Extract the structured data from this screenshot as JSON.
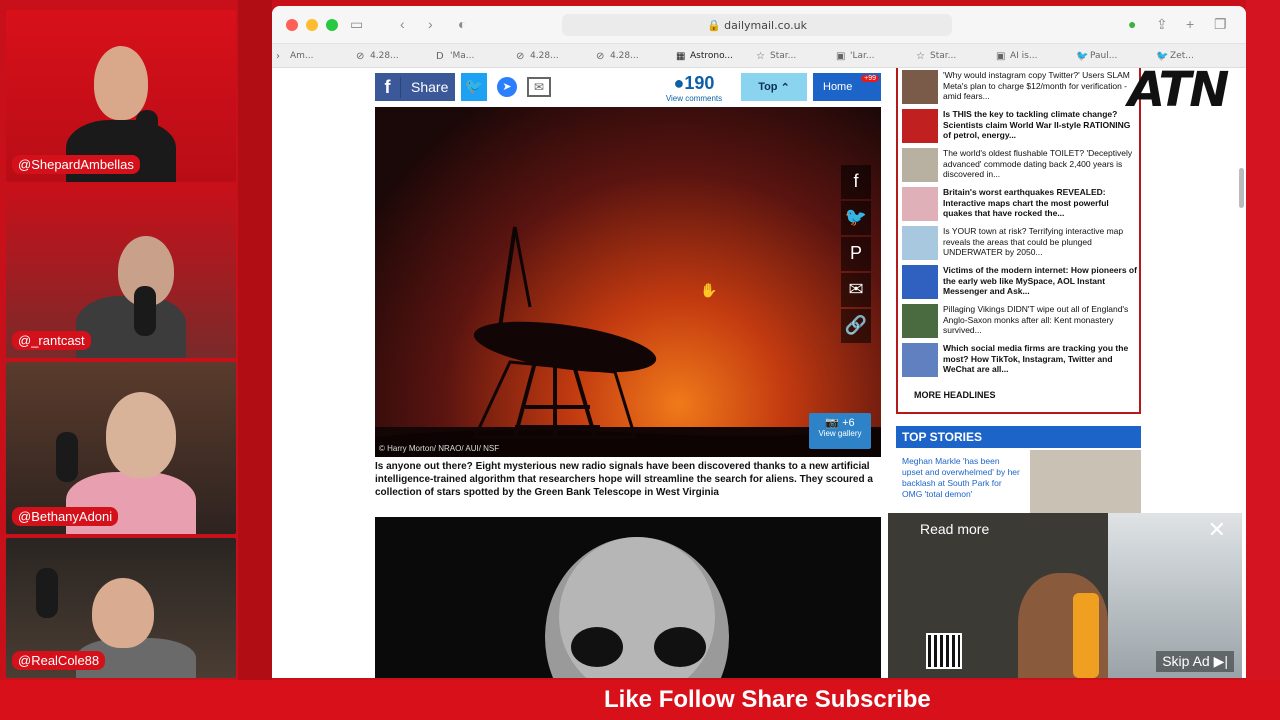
{
  "stream": {
    "handles": [
      "@ShepardAmbellas",
      "@_rantcast",
      "@BethanyAdoni",
      "@RealCole88"
    ],
    "logo": "ATN",
    "banner": "Like Follow Share Subscribe"
  },
  "browser": {
    "url": "dailymail.co.uk",
    "tabs": [
      "Am...",
      "4.28...",
      "'Ma...",
      "4.28...",
      "4.28...",
      "Astrono...",
      "Star...",
      "'Lar...",
      "Star...",
      "AI is...",
      "Paul...",
      "Zet..."
    ]
  },
  "sharebar": {
    "share_label": "Share",
    "comments_count": "190",
    "comments_label": "View comments",
    "top_label": "Top",
    "home_label": "Home",
    "home_badge": "+99"
  },
  "article": {
    "image_credit": "© Harry Morton/ NRAO/ AUI/ NSF",
    "gallery_count": "+6",
    "gallery_label": "View gallery",
    "caption": "Is anyone out there? Eight mysterious new radio signals have been discovered thanks to a new artificial intelligence-trained algorithm that researchers hope will streamline the search for aliens. They scoured a collection of stars spotted by the Green Bank Telescope in West Virginia"
  },
  "headlines": {
    "items": [
      {
        "text": "'Why would instagram copy Twitter?' Users SLAM Meta's plan to charge $12/month for verification - amid fears...",
        "bold": false
      },
      {
        "text": "Is THIS the key to tackling climate change? Scientists claim World War II-style RATIONING of petrol, energy...",
        "bold": true
      },
      {
        "text": "The world's oldest flushable TOILET? 'Deceptively advanced' commode dating back 2,400 years is discovered in...",
        "bold": false
      },
      {
        "text": "Britain's worst earthquakes REVEALED: Interactive maps chart the most powerful quakes that have rocked the...",
        "bold": true
      },
      {
        "text": "Is YOUR town at risk? Terrifying interactive map reveals the areas that could be plunged UNDERWATER by 2050...",
        "bold": false
      },
      {
        "text": "Victims of the modern internet: How pioneers of the early web like MySpace, AOL Instant Messenger and Ask...",
        "bold": true
      },
      {
        "text": "Pillaging Vikings DIDN'T wipe out all of England's Anglo-Saxon monks after all: Kent monastery survived...",
        "bold": false
      },
      {
        "text": "Which social media firms are tracking you the most? How TikTok, Instagram, Twitter and WeChat are all...",
        "bold": true
      }
    ],
    "more_label": "MORE HEADLINES"
  },
  "top_stories": {
    "title": "TOP STORIES",
    "text": "Meghan Markle 'has been upset and overwhelmed' by her backlash at South Park for OMG 'total demon'"
  },
  "ad": {
    "read_more": "Read more",
    "skip": "Skip Ad"
  },
  "colors": {
    "stream_red": "#c8101a",
    "dm_blue": "#1d64c9",
    "headline_border": "#b51a1a"
  }
}
